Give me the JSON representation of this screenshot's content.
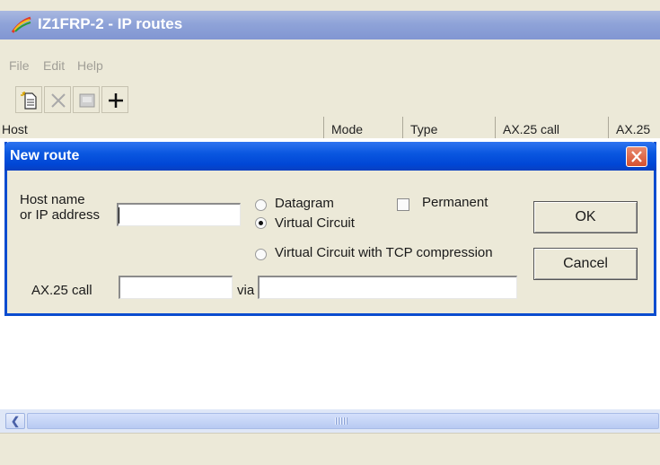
{
  "window": {
    "title": "IZ1FRP-2 - IP routes"
  },
  "menu": [
    "File",
    "Edit",
    "Help"
  ],
  "toolbar": {
    "icons": [
      "new-document-icon",
      "delete-icon",
      "edit-icon",
      "plus-icon"
    ]
  },
  "columns": [
    "Host",
    "Mode",
    "Type",
    "AX.25 call",
    "AX.25"
  ],
  "dialog": {
    "title": "New route",
    "host_label_line1": "Host name",
    "host_label_line2": "or IP address",
    "host_value": "",
    "modes": [
      {
        "label": "Datagram",
        "selected": false
      },
      {
        "label": "Virtual Circuit",
        "selected": true
      },
      {
        "label": "Virtual Circuit with TCP compression",
        "selected": false
      }
    ],
    "permanent_label": "Permanent",
    "permanent_checked": false,
    "ok_label": "OK",
    "cancel_label": "Cancel",
    "ax25_label": "AX.25 call",
    "ax25_value": "",
    "via_label": "via",
    "via_value": ""
  },
  "colors": {
    "dialog_title": "#0046d5",
    "main_title_inactive": "#8fa3d8"
  }
}
